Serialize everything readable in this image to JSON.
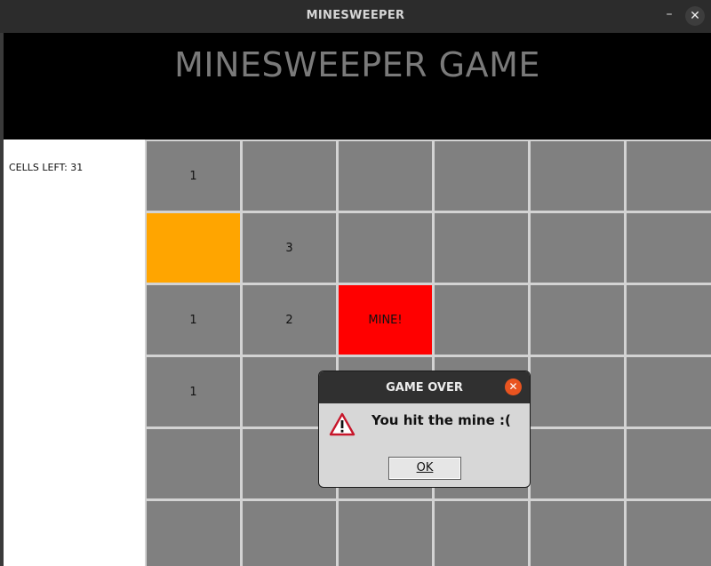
{
  "window": {
    "title": "MINESWEEPER"
  },
  "header": {
    "title": "MINESWEEPER GAME"
  },
  "status": {
    "cells_left": "CELLS LEFT: 31"
  },
  "board": {
    "cols": 6,
    "rows": 6,
    "colors": {
      "unrevealed": "#808080",
      "flag": "#ffa500",
      "mine": "#ff0000",
      "gridline": "#d3d3d3"
    },
    "cells": [
      [
        "1",
        "",
        "",
        "",
        "",
        ""
      ],
      [
        "",
        "3",
        "",
        "",
        "",
        ""
      ],
      [
        "1",
        "2",
        "MINE!",
        "",
        "",
        ""
      ],
      [
        "1",
        "",
        "",
        "",
        "",
        ""
      ],
      [
        "",
        "",
        "",
        "",
        "",
        ""
      ],
      [
        "",
        "",
        "",
        "",
        "",
        ""
      ]
    ],
    "cell_states": [
      [
        "normal",
        "normal",
        "normal",
        "normal",
        "normal",
        "normal"
      ],
      [
        "flag",
        "normal",
        "normal",
        "normal",
        "normal",
        "normal"
      ],
      [
        "normal",
        "normal",
        "mine",
        "normal",
        "normal",
        "normal"
      ],
      [
        "normal",
        "normal",
        "normal",
        "normal",
        "normal",
        "normal"
      ],
      [
        "normal",
        "normal",
        "normal",
        "normal",
        "normal",
        "normal"
      ],
      [
        "normal",
        "normal",
        "normal",
        "normal",
        "normal",
        "normal"
      ]
    ]
  },
  "dialog": {
    "title": "GAME OVER",
    "message": "You hit the mine :(",
    "ok_label": "OK",
    "icon": "warning-icon",
    "close_icon": "close-icon"
  }
}
